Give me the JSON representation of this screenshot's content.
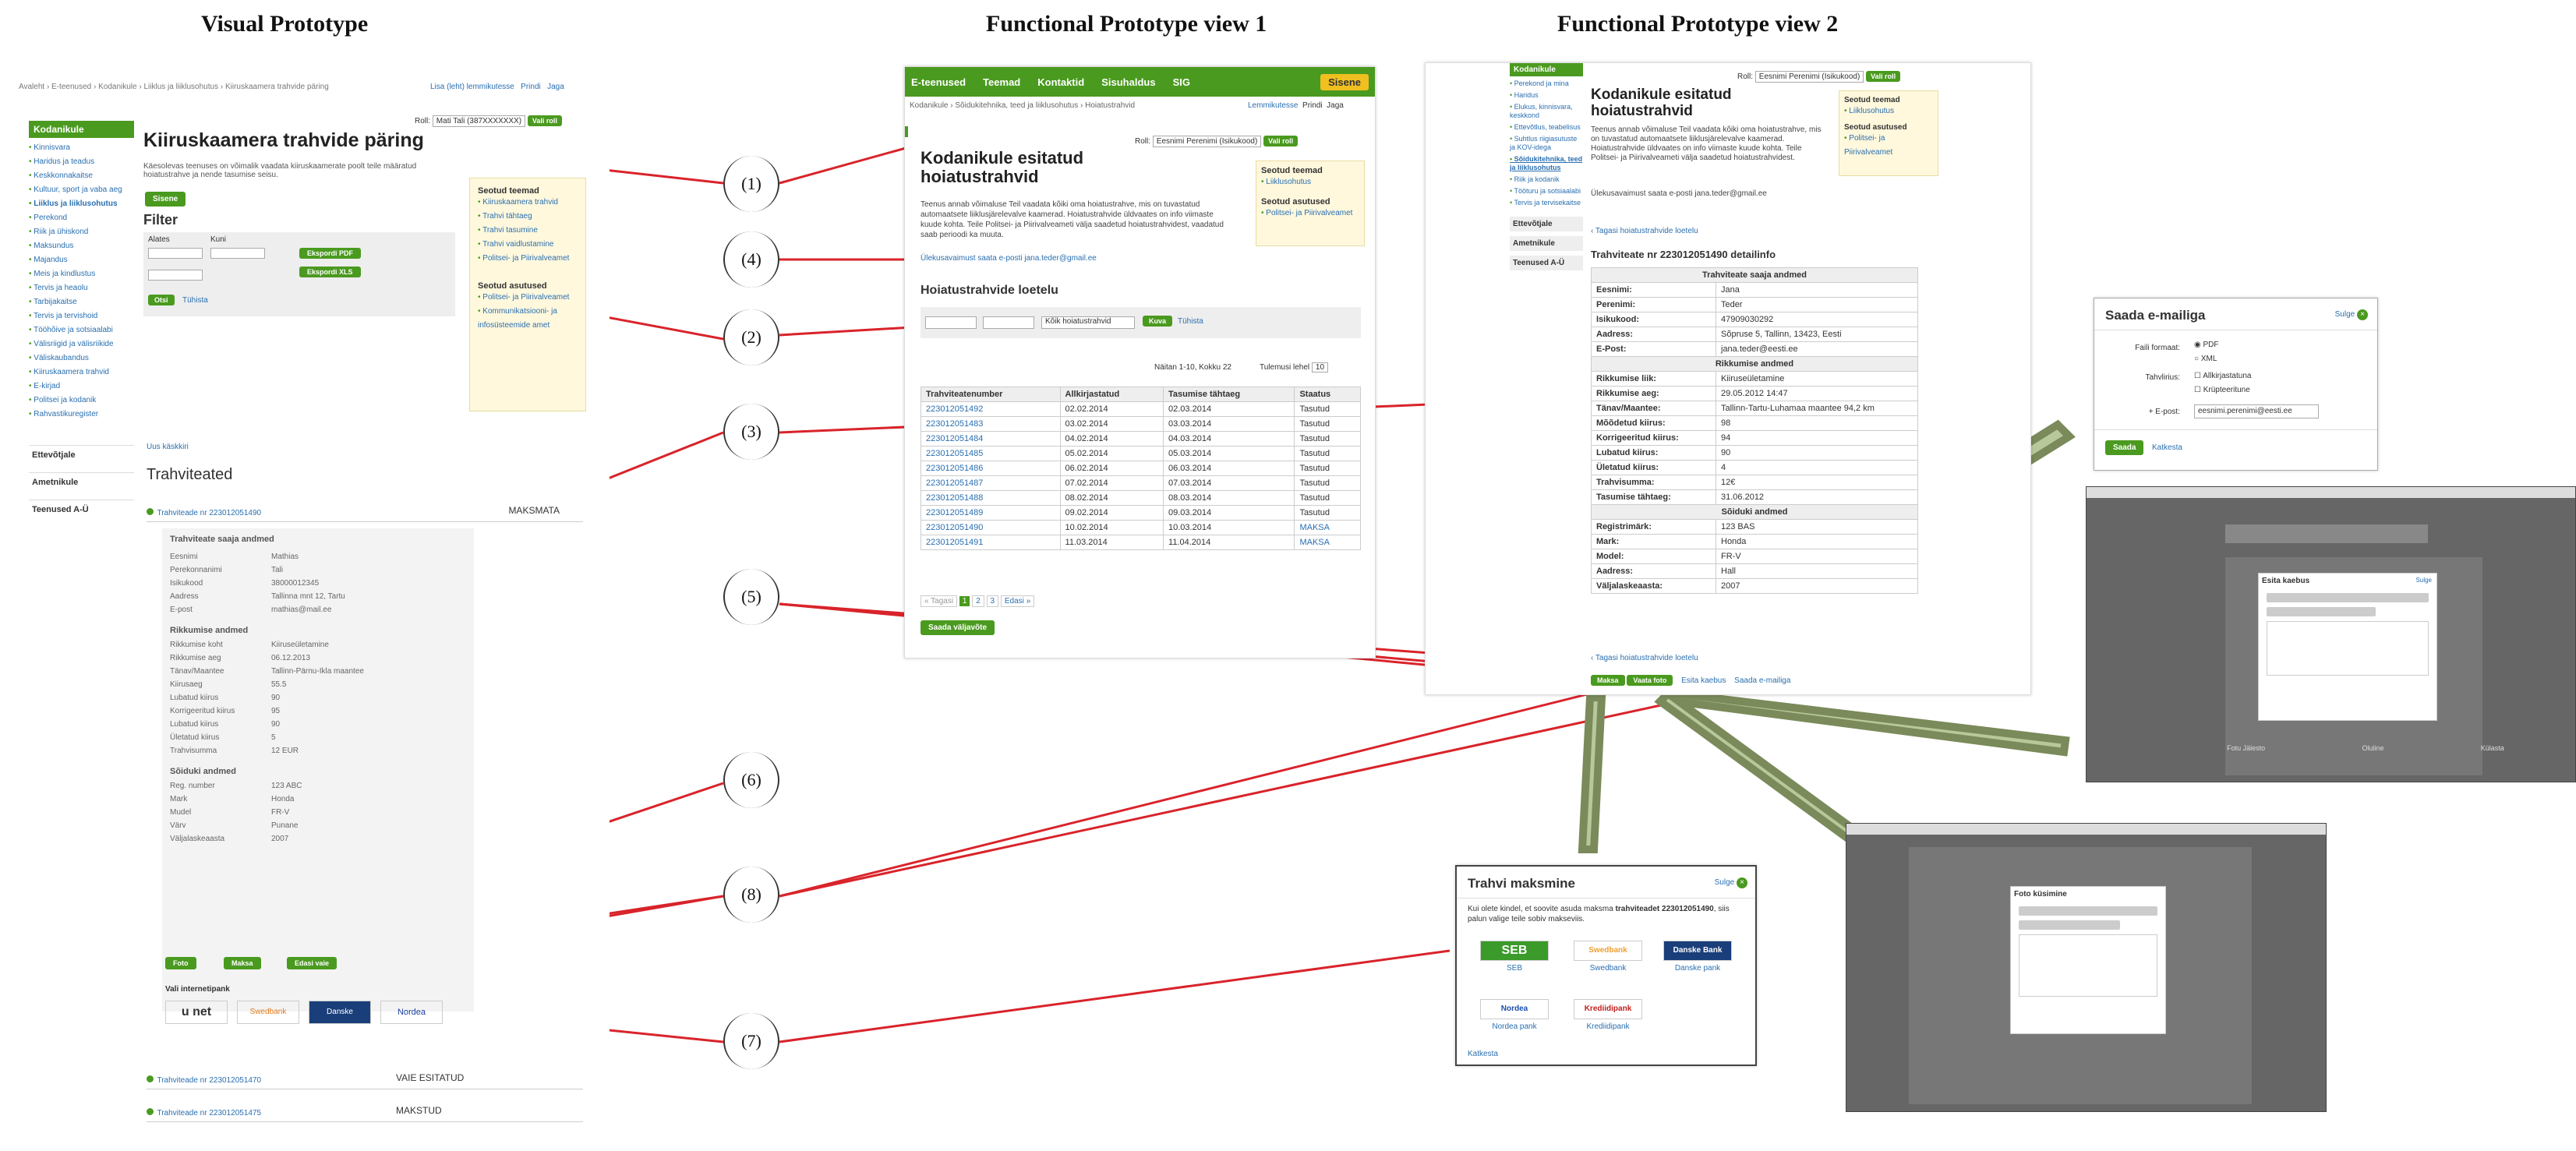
{
  "headings": {
    "col1": "Visual Prototype",
    "col2": "Functional Prototype view 1",
    "col3": "Functional Prototype view 2"
  },
  "markers": [
    "(1)",
    "(2)",
    "(3)",
    "(4)",
    "(5)",
    "(6)",
    "(7)",
    "(8)"
  ],
  "visual": {
    "breadcrumb": "Avaleht › E-teenused › Kodanikule › Liiklus ja liiklusohutus › Kiiruskaamera trahvide päring",
    "top_links": [
      "Lisa (leht) lemmikutesse",
      "Prindi",
      "Jaga"
    ],
    "sidebar_title": "Kodanikule",
    "sidebar": [
      "Kinnisvara",
      "Haridus ja teadus",
      "Keskkonnakaitse",
      "Kultuur, sport ja vaba aeg",
      "Liiklus ja liiklusohutus",
      "Perekond",
      "Riik ja ühiskond",
      "Maksundus",
      "Majandus",
      "Meis ja kindlustus",
      "Tervis ja heaolu",
      "Tarbijakaitse",
      "Tervis ja tervishoid",
      "Tööhõive ja sotsiaalabi",
      "Välisriigid ja välisriikide",
      "Väliskaubandus",
      "Kiiruskaamera trahvid",
      "E-kirjad",
      "Politsei ja kodanik",
      "Rahvastikuregister"
    ],
    "sidebar_sections": [
      "Ettevõtjale",
      "Ametnikule",
      "Teenused A-Ü"
    ],
    "role_label": "Roll:",
    "role_value": "Mati Tali (387XXXXXXX)",
    "role_button": "Vali roll",
    "title": "Kiiruskaamera trahvide päring",
    "intro": "Käesolevas teenuses on võimalik vaadata kiiruskaamerate poolt teile määratud hoiatustrahve ja nende tasumise seisu.",
    "start_button": "Sisene",
    "filter_title": "Filter",
    "filter_from": "Alates",
    "filter_to": "Kuni",
    "pdf_button": "Ekspordi PDF",
    "xls_button": "Ekspordi XLS",
    "filter_button": "Otsi",
    "clear_link": "Tühista",
    "related_title": "Seotud teemad",
    "related": [
      "Kiiruskaamera trahvid",
      "Trahvi tähtaeg",
      "Trahvi tasumine",
      "Trahvi vaidlustamine",
      "Politsei- ja Piirivalveamet"
    ],
    "agencies_title": "Seotud asutused",
    "agencies": [
      "Politsei- ja Piirivalveamet",
      "Kommunikatsiooni- ja infosüsteemide amet"
    ],
    "back_link": "Uus käskkiri",
    "fines_title": "Trahviteated",
    "fine1_link": "Trahviteade nr 223012051490",
    "fine1_status": "MAKSMATA",
    "details_owner": "Trahviteate saaja andmed",
    "owner_rows": [
      [
        "Eesnimi",
        "Mathias"
      ],
      [
        "Perekonnanimi",
        "Tali"
      ],
      [
        "Isikukood",
        "38000012345"
      ],
      [
        "Aadress",
        "Tallinna mnt 12, Tartu"
      ],
      [
        "E-post",
        "mathias@mail.ee"
      ]
    ],
    "violation_title": "Rikkumise andmed",
    "violation_rows": [
      [
        "Rikkumise koht",
        "Kiiruseületamine"
      ],
      [
        "Rikkumise aeg",
        "06.12.2013"
      ],
      [
        "Tänav/Maantee",
        "Tallinn-Pärnu-Ikla maantee"
      ],
      [
        "Kiirusaeg",
        "55.5"
      ],
      [
        "Lubatud kiirus",
        "90"
      ],
      [
        "Korrigeeritud kiirus",
        "95"
      ],
      [
        "Lubatud kiirus",
        "90"
      ],
      [
        "Ületatud kiirus",
        "5"
      ],
      [
        "Trahvisumma",
        "12 EUR"
      ]
    ],
    "vehicle_title": "Sõiduki andmed",
    "vehicle_rows": [
      [
        "Reg. number",
        "123 ABC"
      ],
      [
        "Mark",
        "Honda"
      ],
      [
        "Mudel",
        "FR-V"
      ],
      [
        "Värv",
        "Punane"
      ],
      [
        "Väljalaskeaasta",
        "2007"
      ]
    ],
    "buttons": [
      "Foto",
      "Maksa",
      "Edasi vaie"
    ],
    "bank_label": "Vali internetipank",
    "banks": [
      "u net",
      "Swedbank",
      "Danske",
      "Nordea"
    ],
    "fine2_link": "Trahviteade nr 223012051470",
    "fine2_status": "VAIE ESITATUD",
    "fine3_link": "Trahviteade nr 223012051475",
    "fine3_status": "MAKSTUD"
  },
  "fp1": {
    "nav": [
      "E-teenused",
      "Teemad",
      "Kontaktid",
      "Sisuhaldus",
      "SIG"
    ],
    "login": "Sisene",
    "breadcrumb": "Kodanikule › Sõidukitehnika, teed ja liiklusohutus › Hoiatustrahvid",
    "actions": [
      "Lemmikutesse",
      "Prindi",
      "Jaga"
    ],
    "role_label": "Roll:",
    "role_value": "Eesnimi Perenimi (Isikukood)",
    "role_button": "Vali roll",
    "title": "Kodanikule esitatud hoiatustrahvid",
    "intro": "Teenus annab võimaluse Teil vaadata kõiki oma hoiatustrahve, mis on tuvastatud automaatsete liiklusjärelevalve kaamerad. Hoiatustrahvide üldvaates on info viimaste kuude kohta. Teile Politsei- ja Piirivalveameti välja saadetud hoiatustrahvidest, vaadatud saab perioodi ka muuta.",
    "contact": "Ülekusavaimust saata e-posti jana.teder@gmail.ee",
    "related_title": "Seotud teemad",
    "related": [
      "Liiklusohutus"
    ],
    "agencies_title": "Seotud asutused",
    "agencies": [
      "Politsei- ja Piirivalveamet"
    ],
    "list_title": "Hoiatustrahvide loetelu",
    "select_value": "Kõik hoiatustrahvid",
    "search_button": "Kuva",
    "clear_link": "Tühista",
    "pager_info": "Näitan 1-10, Kokku 22",
    "per_page_label": "Tulemusi lehel",
    "per_page": "10",
    "columns": [
      "Trahviteatenumber",
      "Allkirjastatud",
      "Tasumise tähtaeg",
      "Staatus"
    ],
    "rows": [
      [
        "223012051492",
        "02.02.2014",
        "02.03.2014",
        "Tasutud"
      ],
      [
        "223012051483",
        "03.02.2014",
        "03.03.2014",
        "Tasutud"
      ],
      [
        "223012051484",
        "04.02.2014",
        "04.03.2014",
        "Tasutud"
      ],
      [
        "223012051485",
        "05.02.2014",
        "05.03.2014",
        "Tasutud"
      ],
      [
        "223012051486",
        "06.02.2014",
        "06.03.2014",
        "Tasutud"
      ],
      [
        "223012051487",
        "07.02.2014",
        "07.03.2014",
        "Tasutud"
      ],
      [
        "223012051488",
        "08.02.2014",
        "08.03.2014",
        "Tasutud"
      ],
      [
        "223012051489",
        "09.02.2014",
        "09.03.2014",
        "Tasutud"
      ],
      [
        "223012051490",
        "10.02.2014",
        "10.03.2014",
        "MAKSA"
      ],
      [
        "223012051491",
        "11.03.2014",
        "11.04.2014",
        "MAKSA"
      ]
    ],
    "pages": [
      "« Tagasi",
      "1",
      "2",
      "3",
      "Edasi »"
    ],
    "send_button": "Saada väljavõte"
  },
  "fp2": {
    "sidebar_title": "Kodanikule",
    "sidebar": [
      "Perekond ja mina",
      "Haridus",
      "Elukus, kinnisvara, keskkond",
      "Ettevõtlus, teabelisus",
      "Suhtlus riigiasutuste ja KOV-idega",
      "Sõidukitehnika, teed ja liiklusohutus",
      "Riik ja kodanik",
      "Tööturu ja sotsiaalabi",
      "Tervis ja tervisekaitse"
    ],
    "sidebar_sections": [
      "Ettevõtjale",
      "Ametnikule",
      "Teenused A-Ü"
    ],
    "role_label": "Roll:",
    "role_value": "Eesnimi Perenimi (Isikukood)",
    "role_button": "Vali roll",
    "title": "Kodanikule esitatud hoiatustrahvid",
    "intro": "Teenus annab võimaluse Teil vaadata kõiki oma hoiatustrahve, mis on tuvastatud automaatsete liiklusjärelevalve kaamerad. Hoiatustrahvide üldvaates on info viimaste kuude kohta. Teile Politsei- ja Piirivalveameti välja saadetud hoiatustrahvidest.",
    "contact": "Ülekusavaimust saata e-posti jana.teder@gmail.ee",
    "related_title": "Seotud teemad",
    "related": [
      "Liiklusohutus"
    ],
    "agencies_title": "Seotud asutused",
    "agencies": [
      "Politsei- ja Piirivalveamet"
    ],
    "back": "‹ Tagasi hoiatustrahvide loetelu",
    "detail_title": "Trahviteate nr 223012051490 detailinfo",
    "section_owner": "Trahviteate saaja andmed",
    "owner": [
      [
        "Eesnimi:",
        "Jana"
      ],
      [
        "Perenimi:",
        "Teder"
      ],
      [
        "Isikukood:",
        "47909030292"
      ],
      [
        "Aadress:",
        "Sõpruse 5, Tallinn, 13423, Eesti"
      ],
      [
        "E-Post:",
        "jana.teder@eesti.ee"
      ]
    ],
    "section_violation": "Rikkumise andmed",
    "violation": [
      [
        "Rikkumise liik:",
        "Kiiruseületamine"
      ],
      [
        "Rikkumise aeg:",
        "29.05.2012 14:47"
      ],
      [
        "Tänav/Maantee:",
        "Tallinn-Tartu-Luhamaa maantee 94,2 km"
      ],
      [
        "Mõõdetud kiirus:",
        "98"
      ],
      [
        "Korrigeeritud kiirus:",
        "94"
      ],
      [
        "Lubatud kiirus:",
        "90"
      ],
      [
        "Ületatud kiirus:",
        "4"
      ],
      [
        "Trahvisumma:",
        "12€"
      ],
      [
        "Tasumise tähtaeg:",
        "31.06.2012"
      ]
    ],
    "section_vehicle": "Sõiduki andmed",
    "vehicle": [
      [
        "Registrimärk:",
        "123 BAS"
      ],
      [
        "Mark:",
        "Honda"
      ],
      [
        "Model:",
        "FR-V"
      ],
      [
        "Aadress:",
        "Hall"
      ],
      [
        "Väljalaskeaasta:",
        "2007"
      ]
    ],
    "back2": "‹ Tagasi hoiatustrahvide loetelu",
    "buttons": [
      "Maksa",
      "Vaata foto",
      "Esita kaebus",
      "Saada e-mailiga"
    ]
  },
  "email_dialog": {
    "title": "Saada e-mailiga",
    "close": "Sulge",
    "format_label": "Faili formaat:",
    "formats": [
      "PDF",
      "XML"
    ],
    "attach_label": "Tahvlirius:",
    "attach": [
      "Allkirjastatuna",
      "Krüpteeritune"
    ],
    "email_label": "+ E-post:",
    "email_value": "eesnimi.perenimi@eesti.ee",
    "send": "Saada",
    "cancel": "Katkesta"
  },
  "payment_dialog": {
    "title": "Trahvi maksmine",
    "close": "Sulge",
    "text_a": "Kui olete kindel, et soovite asuda maksma ",
    "text_bold": "trahviteadet 223012051490",
    "text_b": ", siis palun valige teile sobiv makseviis.",
    "banks": [
      {
        "logo": "SEB",
        "name": "SEB"
      },
      {
        "logo": "Swedbank",
        "name": "Swedbank"
      },
      {
        "logo": "Danske Bank",
        "name": "Danske pank"
      },
      {
        "logo": "Nordea",
        "name": "Nordea pank"
      },
      {
        "logo": "Krediidipank",
        "name": "Krediidipank"
      }
    ],
    "cancel": "Katkesta"
  },
  "screen_complaint": {
    "dialog_title": "Esita kaebus",
    "close": "Sulge",
    "footer": [
      "Fotu Jälesto",
      "Oluline",
      "Külasta"
    ]
  },
  "screen_photo": {
    "dialog_title": "Foto küsimine"
  }
}
